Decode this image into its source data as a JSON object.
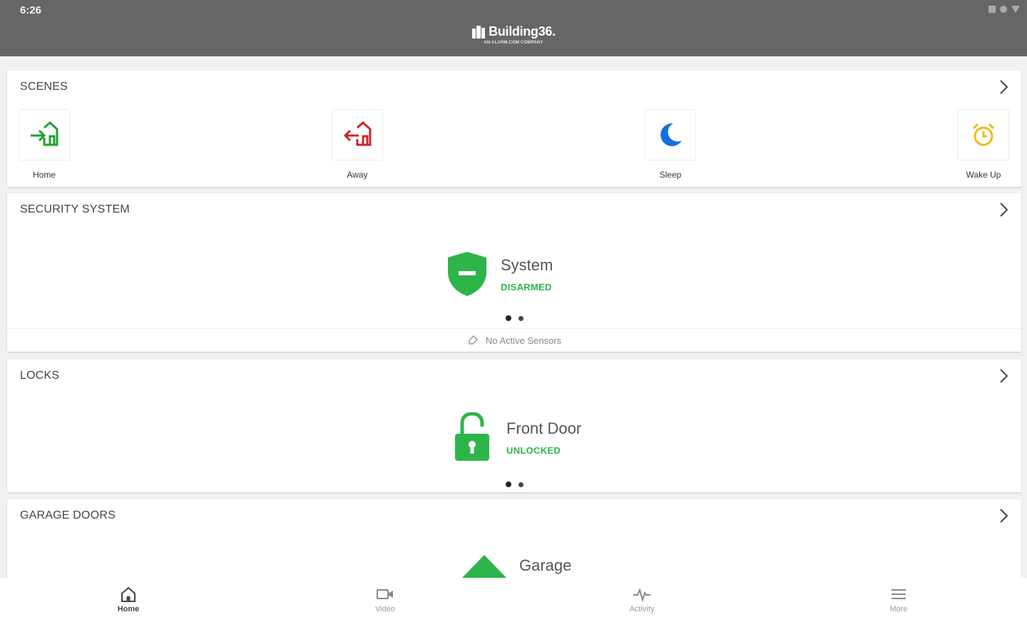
{
  "status_bar": {
    "time": "6:26"
  },
  "header": {
    "logo_name": "Building36.",
    "logo_sub": "AN ALARM.COM COMPANY"
  },
  "scenes": {
    "title": "SCENES",
    "items": [
      {
        "label": "Home",
        "icon": "home-arrive-icon",
        "color": "#1fa22e"
      },
      {
        "label": "Away",
        "icon": "home-leave-icon",
        "color": "#d22424"
      },
      {
        "label": "Sleep",
        "icon": "moon-icon",
        "color": "#1a6fe0"
      },
      {
        "label": "Wake Up",
        "icon": "alarm-clock-icon",
        "color": "#f2b81a"
      }
    ]
  },
  "security": {
    "title": "SECURITY SYSTEM",
    "device_name": "System",
    "device_status": "DISARMED",
    "footer_text": "No Active Sensors",
    "status_color": "#2db54a"
  },
  "locks": {
    "title": "LOCKS",
    "device_name": "Front Door",
    "device_status": "UNLOCKED"
  },
  "garage": {
    "title": "GARAGE DOORS",
    "device_name": "Garage"
  },
  "nav": {
    "items": [
      {
        "label": "Home",
        "icon": "home-icon",
        "active": true
      },
      {
        "label": "Video",
        "icon": "video-camera-icon",
        "active": false
      },
      {
        "label": "Activity",
        "icon": "activity-pulse-icon",
        "active": false
      },
      {
        "label": "More",
        "icon": "menu-icon",
        "active": false
      }
    ]
  }
}
